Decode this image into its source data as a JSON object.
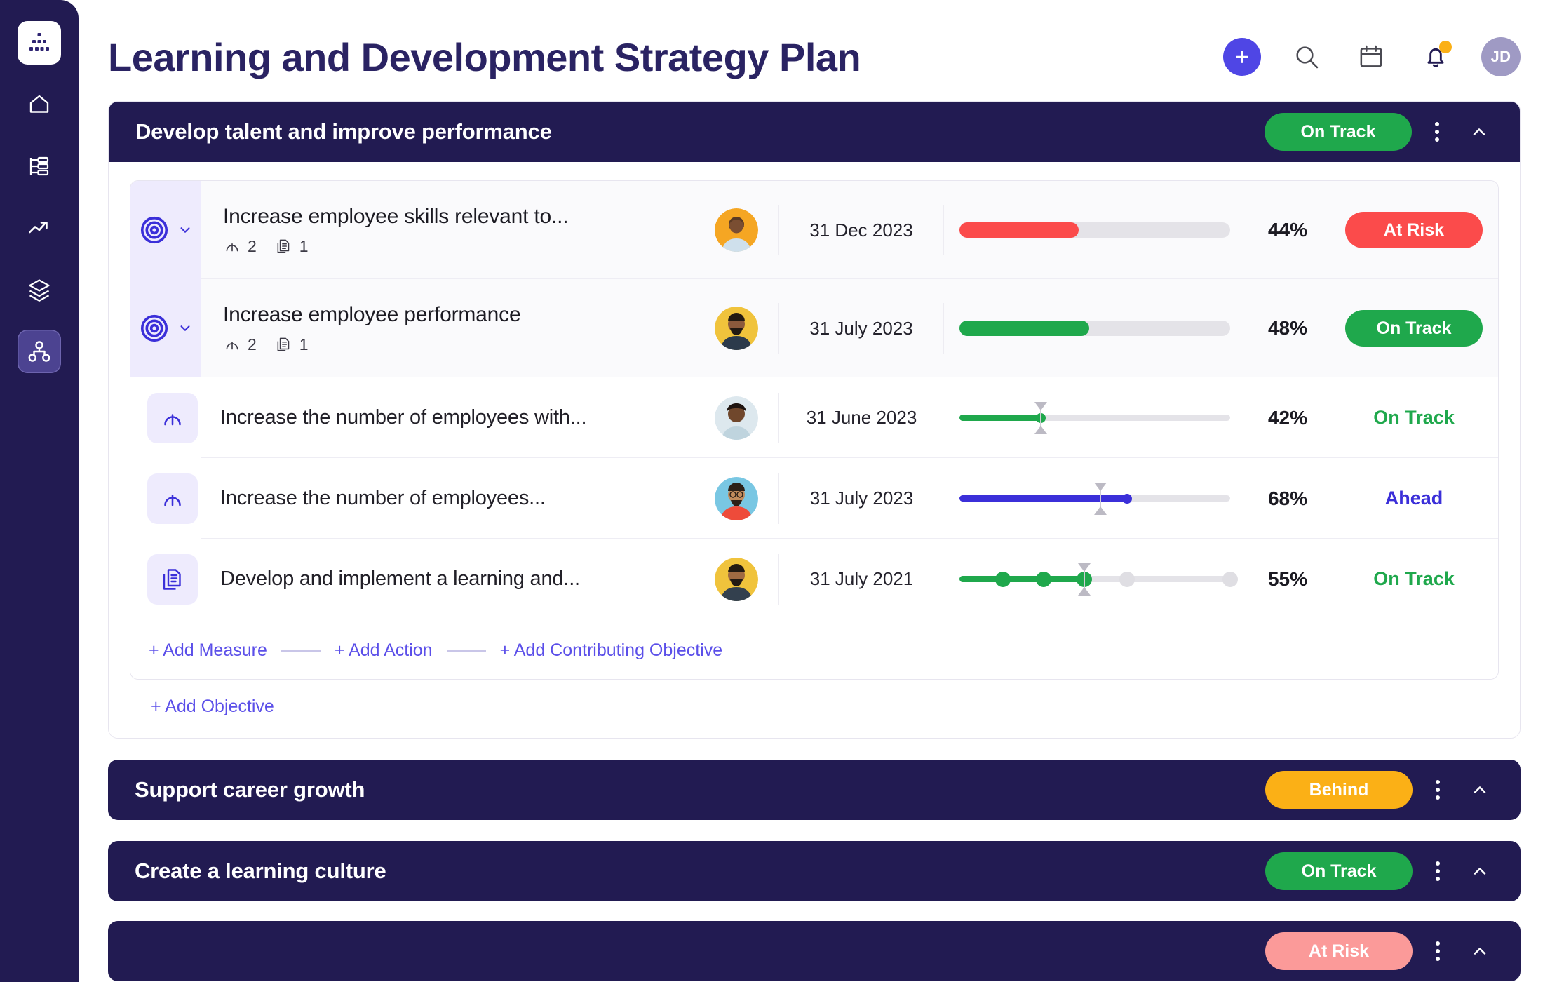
{
  "sidebar": {
    "logo_icon": "org-chart-logo-icon",
    "items": [
      {
        "icon": "home-icon",
        "name": "home",
        "active": false
      },
      {
        "icon": "list-tree-icon",
        "name": "plans",
        "active": false
      },
      {
        "icon": "trending-up-icon",
        "name": "performance",
        "active": false
      },
      {
        "icon": "layers-icon",
        "name": "layers",
        "active": false
      },
      {
        "icon": "hierarchy-icon",
        "name": "strategy-map",
        "active": true
      }
    ]
  },
  "header": {
    "title": "Learning and Development Strategy Plan",
    "actions": [
      {
        "name": "add-button",
        "icon": "plus-icon"
      },
      {
        "name": "search-button",
        "icon": "search-icon"
      },
      {
        "name": "calendar-button",
        "icon": "calendar-icon"
      },
      {
        "name": "notifications-button",
        "icon": "bell-icon",
        "has_dot": true
      }
    ],
    "avatar_initials": "JD"
  },
  "colors": {
    "navy": "#221B52",
    "accent_indigo": "#5B4FE9",
    "green": "#1FA84C",
    "amber": "#FBB016",
    "red": "#FB4B4B",
    "red_faded": "#FB9A99",
    "blue_ahead": "#3B2FD9",
    "track_grey": "#E4E3E8"
  },
  "objective": {
    "title": "Develop talent and improve performance",
    "status": "On Track",
    "status_kind": "ontrack",
    "rows": [
      {
        "kind": "objective",
        "icon": "target-icon",
        "name": "Increase employee skills relevant to...",
        "meta": [
          {
            "icon": "measure-gauge-icon",
            "count": "2"
          },
          {
            "icon": "action-document-icon",
            "count": "1"
          }
        ],
        "avatar": "avatar-1",
        "date": "31 Dec 2023",
        "progress": 44,
        "percent": "44%",
        "bar_style": "thick",
        "bar_color": "#FB4B4B",
        "status": "At Risk",
        "status_kind": "atrisk",
        "status_style": "badge"
      },
      {
        "kind": "objective",
        "icon": "target-icon",
        "name": "Increase employee performance",
        "meta": [
          {
            "icon": "measure-gauge-icon",
            "count": "2"
          },
          {
            "icon": "action-document-icon",
            "count": "1"
          }
        ],
        "avatar": "avatar-2",
        "date": "31 July 2023",
        "progress": 48,
        "percent": "48%",
        "bar_style": "thick",
        "bar_color": "#1FA84C",
        "status": "On Track",
        "status_kind": "ontrack",
        "status_style": "badge"
      },
      {
        "kind": "measure",
        "icon": "measure-gauge-icon",
        "name": "Increase the number of employees with...",
        "meta": [],
        "avatar": "avatar-3",
        "date": "31 June 2023",
        "progress": 30,
        "target_marker": 30,
        "percent": "42%",
        "bar_style": "slider",
        "bar_color": "#1FA84C",
        "status": "On Track",
        "status_kind": "ontrack",
        "status_style": "text"
      },
      {
        "kind": "measure",
        "icon": "measure-gauge-icon",
        "name": "Increase the number of employees...",
        "meta": [],
        "avatar": "avatar-4",
        "date": "31 July 2023",
        "progress": 62,
        "target_marker": 52,
        "percent": "68%",
        "bar_style": "slider",
        "bar_color": "#3B2FD9",
        "status": "Ahead",
        "status_kind": "ahead",
        "status_style": "text"
      },
      {
        "kind": "action",
        "icon": "action-document-icon",
        "name": "Develop and implement a learning and...",
        "meta": [],
        "avatar": "avatar-5",
        "date": "31 July 2021",
        "progress": 46,
        "target_marker": 46,
        "percent": "55%",
        "bar_style": "milestones",
        "bar_color": "#1FA84C",
        "milestones": [
          {
            "pos": 16,
            "done": true
          },
          {
            "pos": 31,
            "done": true
          },
          {
            "pos": 46,
            "done": true
          },
          {
            "pos": 62,
            "done": false
          },
          {
            "pos": 100,
            "done": false
          }
        ],
        "status": "On Track",
        "status_kind": "ontrack",
        "status_style": "text"
      }
    ],
    "add_links": [
      "+ Add Measure",
      "+ Add Action",
      "+ Add Contributing Objective"
    ],
    "add_objective": "+ Add Objective"
  },
  "collapsed_objectives": [
    {
      "title": "Support career growth",
      "status": "Behind",
      "status_kind": "behind"
    },
    {
      "title": "Create a learning culture",
      "status": "On Track",
      "status_kind": "ontrack"
    },
    {
      "title": "",
      "status": "At Risk",
      "status_kind": "atrisk-faded"
    }
  ]
}
